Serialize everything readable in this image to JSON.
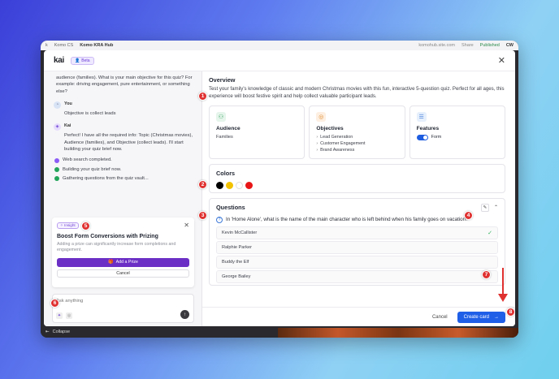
{
  "appbar": {
    "crumb": "Komo CS",
    "title": "Komo KRA Hub",
    "right_link": "komohub.site.com",
    "share": "Share",
    "status": "Published",
    "user": "CW"
  },
  "modal": {
    "logo": "kai",
    "beta": "Beta",
    "close": "✕"
  },
  "chat": {
    "intro": "audience (families). What is your main objective for this quiz? For example: driving engagement, pure entertainment, or something else?",
    "you_label": "You",
    "you_text": "Objective is collect leads",
    "kai_label": "Kai",
    "kai_text": "Perfect! I have all the required info: Topic (Christmas movies), Audience (families), and Objective (collect leads). I'll start building your quiz brief now.",
    "status": [
      {
        "text": "Web search completed.",
        "state": "purple"
      },
      {
        "text": "Building your quiz brief now.",
        "state": "green"
      },
      {
        "text": "Gathering questions from the quiz vault...",
        "state": "green"
      }
    ]
  },
  "insight": {
    "tag": "Insight",
    "title": "Boost Form Conversions with Prizing",
    "desc": "Adding a prize can significantly increase form completions and engagement.",
    "add_prize": "Add a Prize",
    "cancel": "Cancel"
  },
  "ask": {
    "placeholder": "Ask anything"
  },
  "overview": {
    "title": "Overview",
    "text": "Test your family's knowledge of classic and modern Christmas movies with this fun, interactive 5-question quiz. Perfect for all ages, this experience will boost festive spirit and help collect valuable participant leads."
  },
  "cards": {
    "audience": {
      "title": "Audience",
      "value": "Families"
    },
    "objectives": {
      "title": "Objectives",
      "items": [
        "Lead Generation",
        "Customer Engagement",
        "Brand Awareness"
      ]
    },
    "features": {
      "title": "Features",
      "toggle_label": "Form"
    }
  },
  "colors": {
    "title": "Colors",
    "swatches": [
      "#000000",
      "#f2c200",
      "#ffffff",
      "#e81616"
    ]
  },
  "questions": {
    "title": "Questions",
    "question": "In 'Home Alone', what is the name of the main character who is left behind when his family goes on vacation?",
    "answers": [
      {
        "text": "Kevin McCallister",
        "correct": true
      },
      {
        "text": "Ralphie Parker",
        "correct": false
      },
      {
        "text": "Buddy the Elf",
        "correct": false
      },
      {
        "text": "George Bailey",
        "correct": false
      }
    ]
  },
  "footer": {
    "cancel": "Cancel",
    "create": "Create card"
  },
  "bottom": {
    "collapse": "Collapse"
  },
  "markers": [
    "1",
    "2",
    "3",
    "4",
    "5",
    "6",
    "7",
    "8"
  ],
  "accent_colors": {
    "primary": "#1f5fe8",
    "prize": "#6b2fc6",
    "marker": "#e03131"
  }
}
